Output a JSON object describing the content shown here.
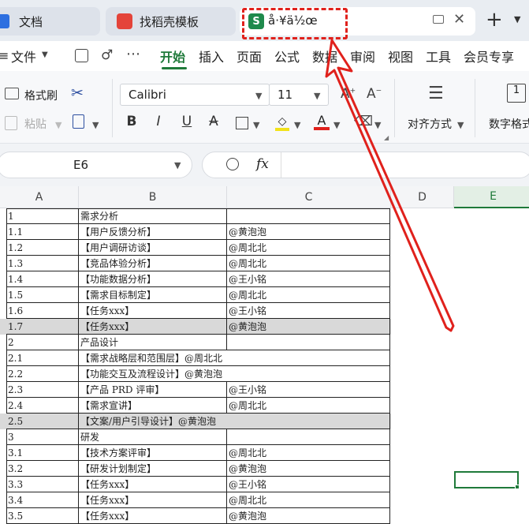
{
  "tabs": [
    {
      "label": "文档",
      "badge": ""
    },
    {
      "label": "找稻壳模板",
      "badge": ""
    },
    {
      "label": "å·¥ä½œ",
      "badge": "S"
    }
  ],
  "tab_new": "+",
  "menu": {
    "file": "文件",
    "more": "⋯",
    "items": [
      "开始",
      "插入",
      "页面",
      "公式",
      "数据",
      "审阅",
      "视图",
      "工具",
      "会员专享"
    ]
  },
  "ribbon": {
    "format_painter": "格式刷",
    "paste": "粘贴",
    "font_name": "Calibri",
    "font_size": "11",
    "align": "对齐方式",
    "number_format": "数字格式"
  },
  "formula_bar": {
    "name_box": "E6",
    "fx": "fx"
  },
  "columns": [
    "A",
    "B",
    "C",
    "D",
    "E"
  ],
  "selected_cell": "E6",
  "rows": [
    {
      "a": "1",
      "b": "需求分析",
      "c": "",
      "hl": false
    },
    {
      "a": "1.1",
      "b": "【用户反馈分析】",
      "c": "@黄泡泡",
      "hl": false
    },
    {
      "a": "1.2",
      "b": "【用户调研访谈】",
      "c": "@周北北",
      "hl": false
    },
    {
      "a": "1.3",
      "b": "【竞品体验分析】",
      "c": "@周北北",
      "hl": false
    },
    {
      "a": "1.4",
      "b": "【功能数据分析】",
      "c": "@王小铭",
      "hl": false
    },
    {
      "a": "1.5",
      "b": "【需求目标制定】",
      "c": "@周北北",
      "hl": false
    },
    {
      "a": "1.6",
      "b": "【任务xxx】",
      "c": "@王小铭",
      "hl": false
    },
    {
      "a": "1.7",
      "b": "【任务xxx】",
      "c": "@黄泡泡",
      "hl": true
    },
    {
      "a": "2",
      "b": "产品设计",
      "c": "",
      "hl": false
    },
    {
      "a": "2.1",
      "b": "【需求战略层和范围层】@周北北",
      "c": "",
      "hl": false
    },
    {
      "a": "2.2",
      "b": "【功能交互及流程设计】@黄泡泡",
      "c": "",
      "hl": false
    },
    {
      "a": "2.3",
      "b": "【产品 PRD 评审】",
      "c": "@王小铭",
      "hl": false
    },
    {
      "a": "2.4",
      "b": "【需求宣讲】",
      "c": "@周北北",
      "hl": false
    },
    {
      "a": "2.5",
      "b": "【文案/用户引导设计】@黄泡泡",
      "c": "",
      "hl": true
    },
    {
      "a": "3",
      "b": "研发",
      "c": "",
      "hl": false
    },
    {
      "a": "3.1",
      "b": "【技术方案评审】",
      "c": "@周北北",
      "hl": false
    },
    {
      "a": "3.2",
      "b": "【研发计划制定】",
      "c": "@黄泡泡",
      "hl": false
    },
    {
      "a": "3.3",
      "b": "【任务xxx】",
      "c": "@王小铭",
      "hl": false
    },
    {
      "a": "3.4",
      "b": "【任务xxx】",
      "c": "@周北北",
      "hl": false
    },
    {
      "a": "3.5",
      "b": "【任务xxx】",
      "c": "@黄泡泡",
      "hl": false
    }
  ],
  "colors": {
    "accent": "#1f7a3a",
    "annotation": "#e0211c",
    "highlight_row": "#d9d9d9"
  }
}
